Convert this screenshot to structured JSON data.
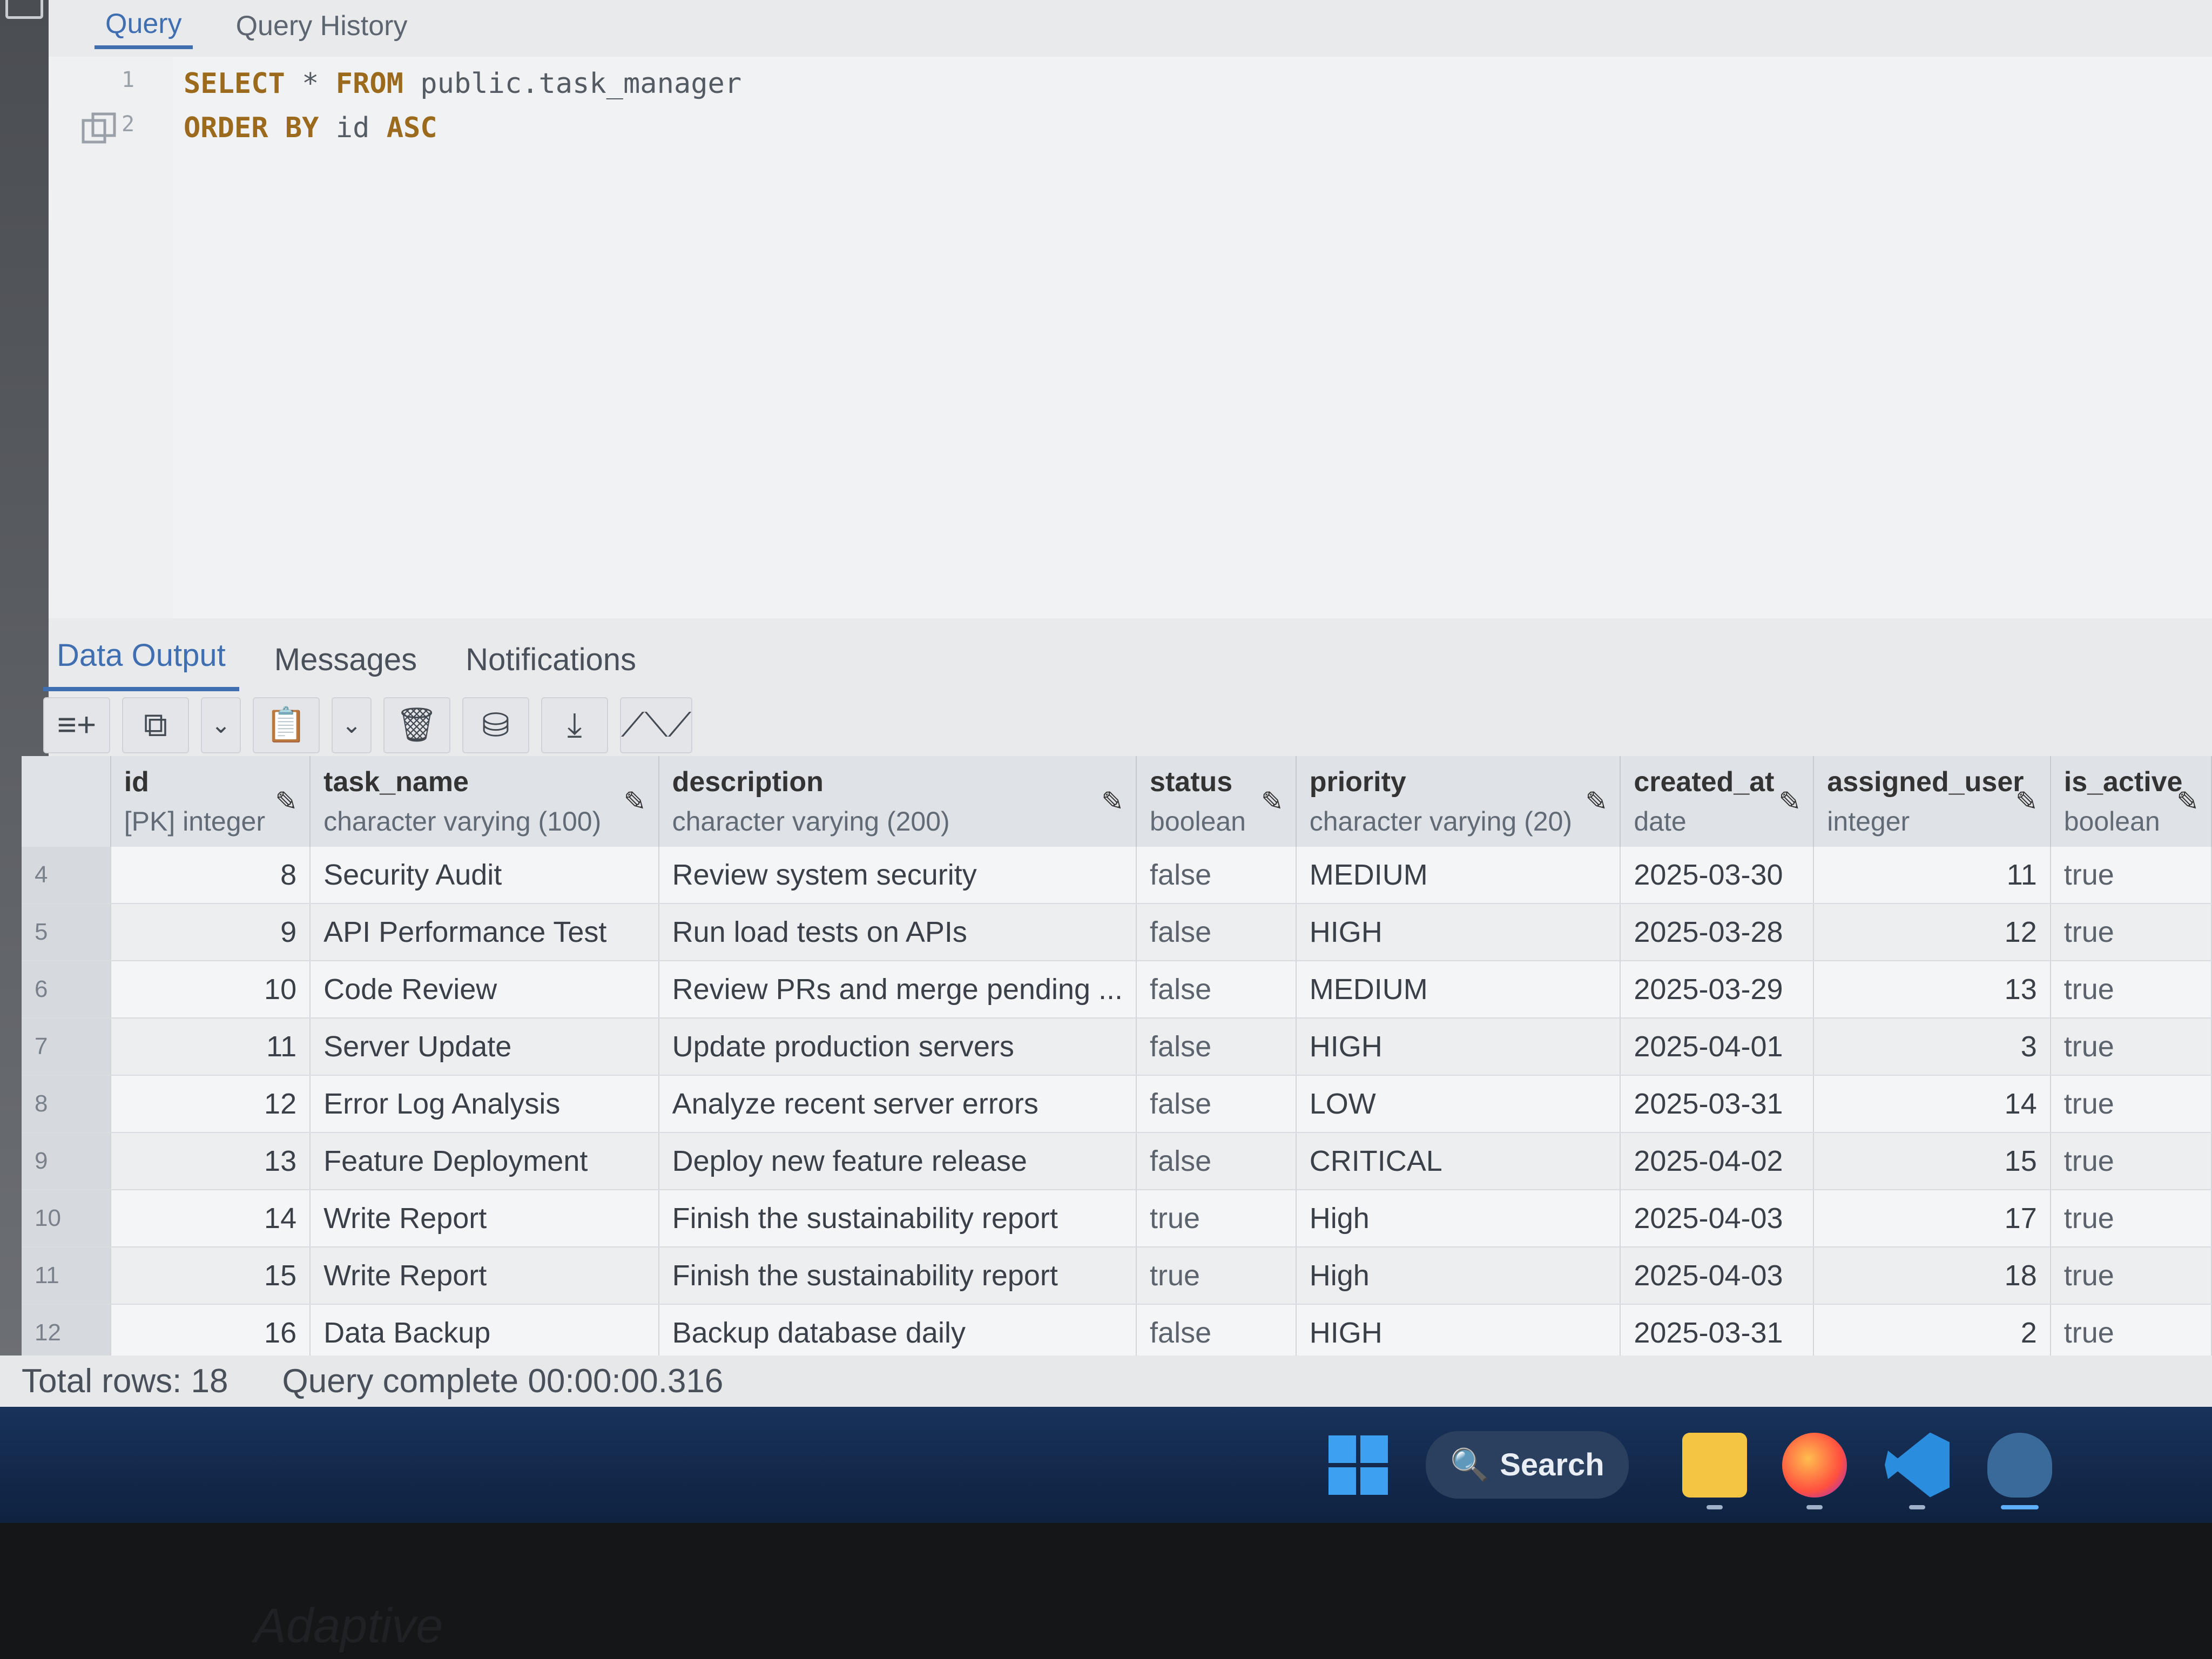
{
  "query_tabs": [
    "Query",
    "Query History"
  ],
  "editor": {
    "lines": [
      {
        "num": "1",
        "parts": [
          [
            "kw",
            "SELECT"
          ],
          [
            "ident",
            " * "
          ],
          [
            "kw",
            "FROM"
          ],
          [
            "ident",
            " public.task_manager"
          ]
        ]
      },
      {
        "num": "2",
        "parts": [
          [
            "kw",
            "ORDER BY"
          ],
          [
            "ident",
            " id "
          ],
          [
            "kw",
            "ASC"
          ]
        ]
      }
    ]
  },
  "panel_tabs": [
    "Data Output",
    "Messages",
    "Notifications"
  ],
  "toolbar": {
    "buttons": [
      "add-row",
      "copy",
      "copy-options",
      "paste",
      "paste-options",
      "delete",
      "save-data",
      "download",
      "graph"
    ]
  },
  "grid": {
    "columns": [
      {
        "name": "id",
        "type": "[PK] integer"
      },
      {
        "name": "task_name",
        "type": "character varying (100)"
      },
      {
        "name": "description",
        "type": "character varying (200)"
      },
      {
        "name": "status",
        "type": "boolean"
      },
      {
        "name": "priority",
        "type": "character varying (20)"
      },
      {
        "name": "created_at",
        "type": "date"
      },
      {
        "name": "assigned_user",
        "type": "integer"
      },
      {
        "name": "is_active",
        "type": "boolean"
      }
    ],
    "rows": [
      {
        "rownum": "4",
        "cells": [
          "8",
          "Security Audit",
          "Review system security",
          "false",
          "MEDIUM",
          "2025-03-30",
          "11",
          "true"
        ]
      },
      {
        "rownum": "5",
        "cells": [
          "9",
          "API Performance Test",
          "Run load tests on APIs",
          "false",
          "HIGH",
          "2025-03-28",
          "12",
          "true"
        ]
      },
      {
        "rownum": "6",
        "cells": [
          "10",
          "Code Review",
          "Review PRs and merge pending ...",
          "false",
          "MEDIUM",
          "2025-03-29",
          "13",
          "true"
        ]
      },
      {
        "rownum": "7",
        "cells": [
          "11",
          "Server Update",
          "Update production servers",
          "false",
          "HIGH",
          "2025-04-01",
          "3",
          "true"
        ]
      },
      {
        "rownum": "8",
        "cells": [
          "12",
          "Error Log Analysis",
          "Analyze recent server errors",
          "false",
          "LOW",
          "2025-03-31",
          "14",
          "true"
        ]
      },
      {
        "rownum": "9",
        "cells": [
          "13",
          "Feature Deployment",
          "Deploy new feature release",
          "false",
          "CRITICAL",
          "2025-04-02",
          "15",
          "true"
        ]
      },
      {
        "rownum": "10",
        "cells": [
          "14",
          "Write Report",
          "Finish the sustainability report",
          "true",
          "High",
          "2025-04-03",
          "17",
          "true"
        ]
      },
      {
        "rownum": "11",
        "cells": [
          "15",
          "Write Report",
          "Finish the sustainability report",
          "true",
          "High",
          "2025-04-03",
          "18",
          "true"
        ]
      },
      {
        "rownum": "12",
        "cells": [
          "16",
          "Data Backup",
          "Backup database daily",
          "false",
          "HIGH",
          "2025-03-31",
          "2",
          "true"
        ]
      }
    ]
  },
  "status": {
    "total_rows": "Total rows: 18",
    "query_complete": "Query complete 00:00:00.316"
  },
  "taskbar": {
    "search_label": "Search"
  },
  "bezel_text": "Adaptive"
}
